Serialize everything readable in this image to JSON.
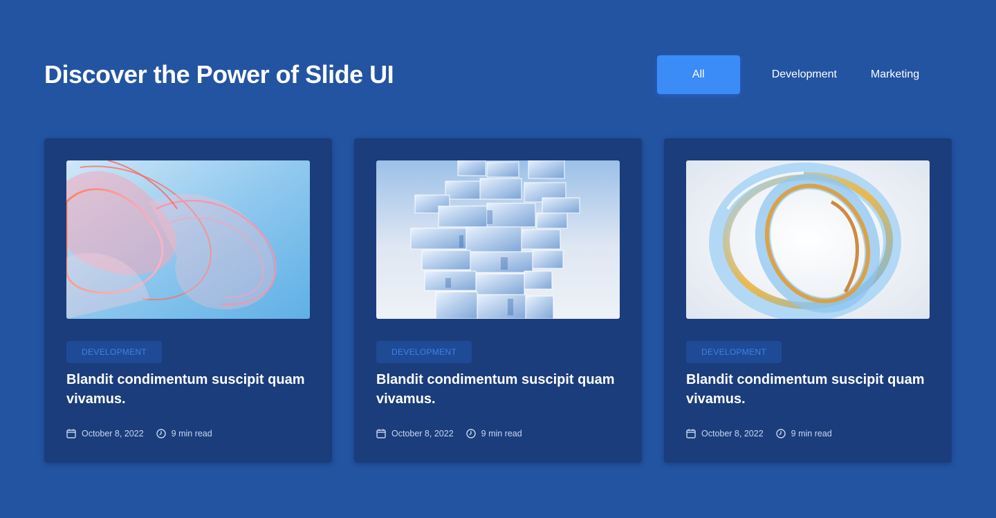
{
  "header": {
    "title": "Discover the Power of Slide UI",
    "tabs": [
      {
        "label": "All",
        "active": true
      },
      {
        "label": "Development",
        "active": false
      },
      {
        "label": "Marketing",
        "active": false
      }
    ]
  },
  "colors": {
    "background": "#2354a2",
    "card": "#1b3d7c",
    "accent": "#3b8cf6",
    "tag_text": "#3b82e6"
  },
  "cards": [
    {
      "tag": "DEVELOPMENT",
      "title": "Blandit condimentum suscipit quam vivamus.",
      "date": "October 8, 2022",
      "read_time": "9 min read",
      "image": "abstract-glass-waves-image"
    },
    {
      "tag": "DEVELOPMENT",
      "title": "Blandit condimentum suscipit quam vivamus.",
      "date": "October 8, 2022",
      "read_time": "9 min read",
      "image": "glass-cube-tower-image"
    },
    {
      "tag": "DEVELOPMENT",
      "title": "Blandit condimentum suscipit quam vivamus.",
      "date": "October 8, 2022",
      "read_time": "9 min read",
      "image": "glass-ring-image"
    }
  ]
}
